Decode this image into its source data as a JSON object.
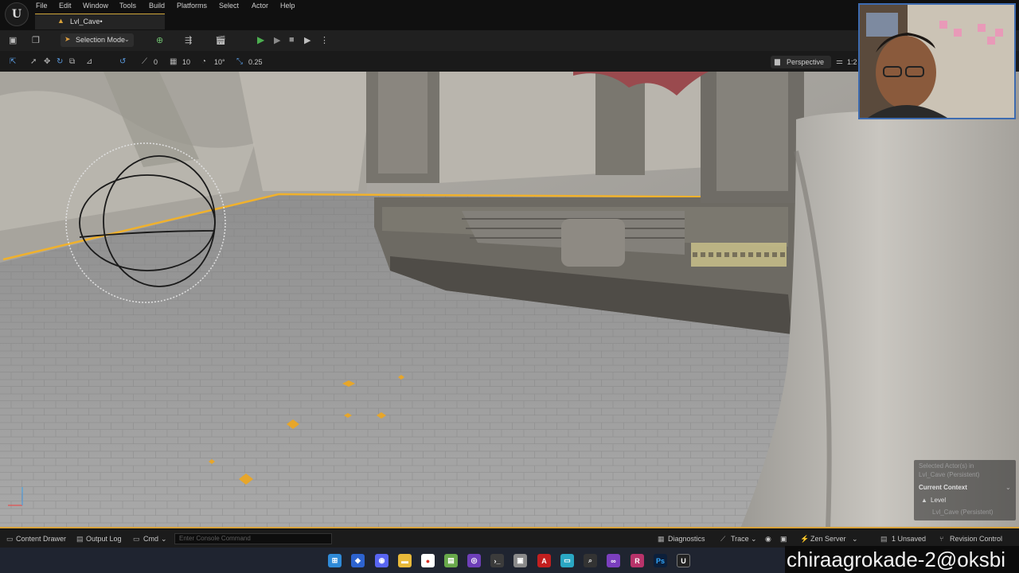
{
  "app": {
    "menu": [
      "File",
      "Edit",
      "Window",
      "Tools",
      "Build",
      "Platforms",
      "Select",
      "Actor",
      "Help"
    ],
    "logo_letter": "U"
  },
  "tab": {
    "label": "Lvl_Cave•"
  },
  "toolbar": {
    "selection_mode": "Selection Mode",
    "chevron": "⌄"
  },
  "viewport_toolbar": {
    "rotation_snap": "0",
    "grid_snap": "10",
    "angle_snap": "10°",
    "scale_snap": "0.25",
    "view_mode": "Perspective",
    "extra": "1:2"
  },
  "context_panel": {
    "selected": "Selected Actor(s) in",
    "selected_level": "Lvl_Cave (Persistent)",
    "current_context": "Current Context",
    "level": "Level",
    "level_name": "Lvl_Cave (Persistent)"
  },
  "statusbar": {
    "content_drawer": "Content Drawer",
    "output_log": "Output Log",
    "cmd": "Cmd",
    "console_placeholder": "Enter Console Command",
    "diagnostics": "Diagnostics",
    "trace": "Trace",
    "zen_server": "Zen Server",
    "unsaved": "1 Unsaved",
    "revision_control": "Revision Control"
  },
  "watermark": "chiraagrokade-2@oksbi",
  "colors": {
    "accent": "#d8a23a",
    "play": "#4caf50",
    "webcam_border": "#3d6bb0"
  }
}
